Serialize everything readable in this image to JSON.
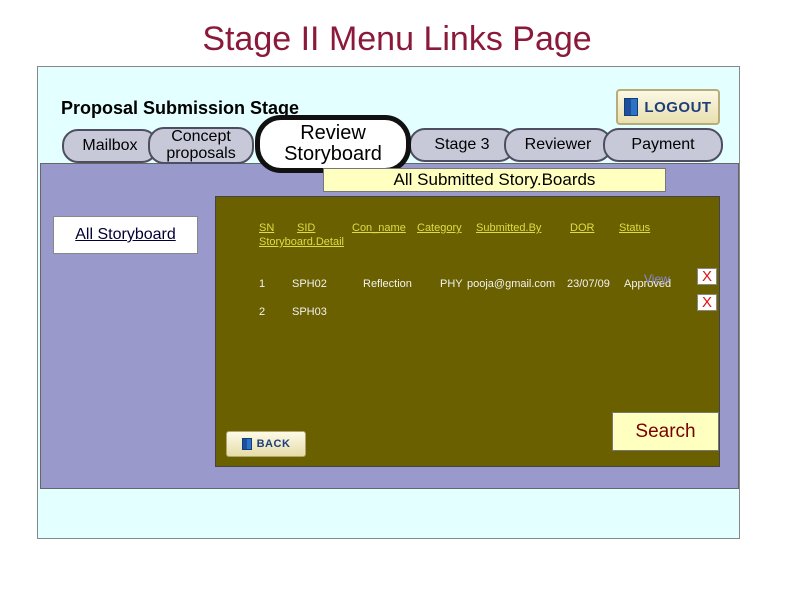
{
  "page_title": "Stage II Menu Links Page",
  "stage_label": "Proposal Submission Stage",
  "logout_label": "LOGOUT",
  "tabs": {
    "mailbox": "Mailbox",
    "concept_line1": "Concept",
    "concept_line2": "proposals",
    "review_line1": "Review",
    "review_line2": "Storyboard",
    "stage3": "Stage 3",
    "reviewer": "Reviewer",
    "payment": "Payment"
  },
  "section_title": "All Submitted Story.Boards",
  "sidebar": {
    "all_storyboard": "All Storyboard"
  },
  "table": {
    "headers": {
      "sn": "SN",
      "sid": "SID",
      "con_name": "Con_name",
      "category": "Category",
      "submitted_by": "Submitted.By",
      "dor": "DOR",
      "status": "Status",
      "detail": "Storyboard.Detail"
    },
    "rows": [
      {
        "sn": "1",
        "sid": "SPH02",
        "con_name": "Reflection",
        "category": "PHY",
        "submitted_by": "pooja@gmail.com",
        "dor": "23/07/09",
        "status": "Approved",
        "detail": "View",
        "delete": "X"
      },
      {
        "sn": "2",
        "sid": "SPH03",
        "delete": "X"
      }
    ]
  },
  "search_label": "Search",
  "back_label": "BACK",
  "colors": {
    "title": "#8b1a3a",
    "outer_bg": "#e4ffff",
    "mid_bg": "#9999cc",
    "panel_bg": "#6b6000",
    "highlight_bg": "#ffffc0",
    "delete_x": "#dd1111"
  }
}
